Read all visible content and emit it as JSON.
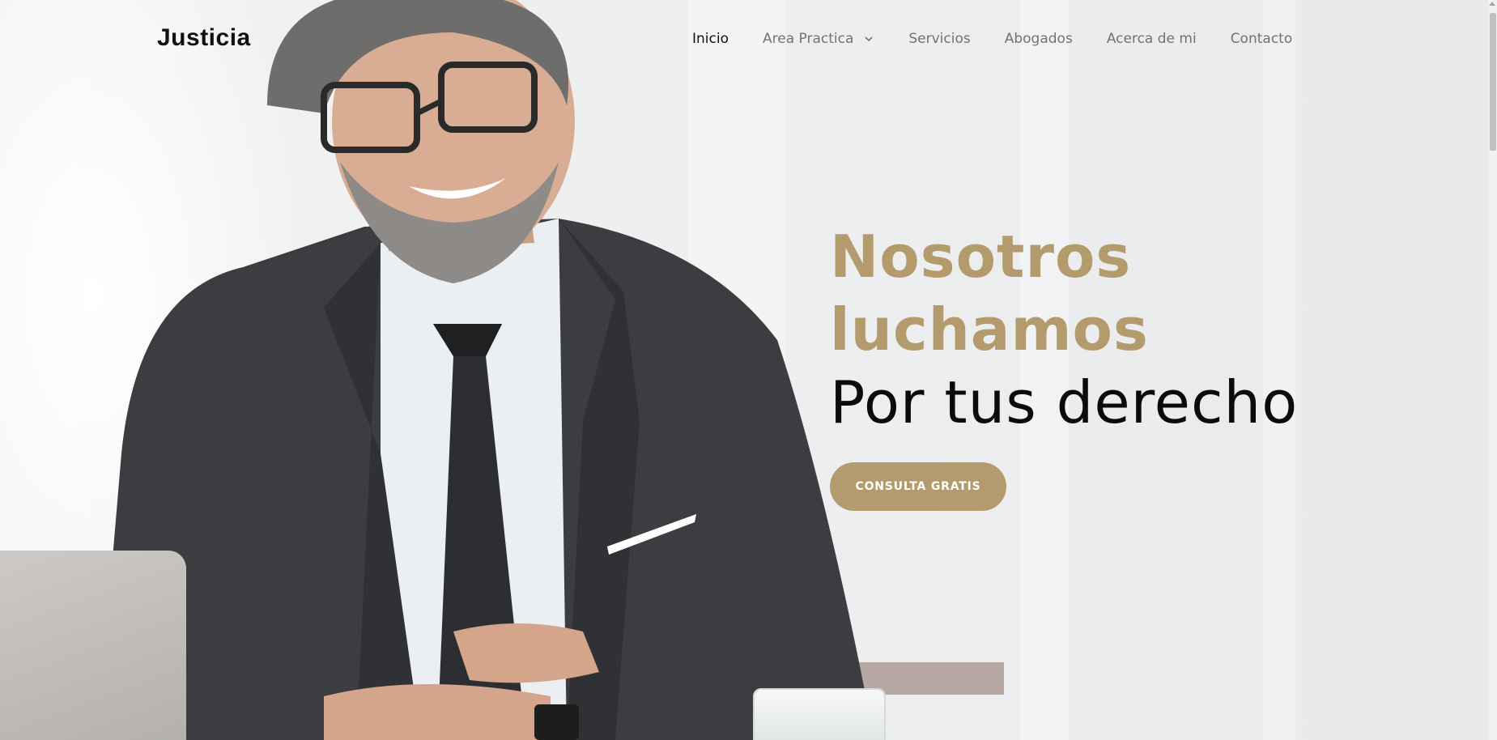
{
  "brand": {
    "name": "Justicia"
  },
  "nav": {
    "items": [
      {
        "label": "Inicio",
        "active": true
      },
      {
        "label": "Area Practica",
        "has_dropdown": true
      },
      {
        "label": "Servicios"
      },
      {
        "label": "Abogados"
      },
      {
        "label": "Acerca de mi"
      },
      {
        "label": "Contacto"
      }
    ]
  },
  "hero": {
    "line1": "Nosotros",
    "line2": "luchamos",
    "line3": "Por tus derecho",
    "cta_label": "CONSULTA GRATIS",
    "photo_alt": "smiling-lawyer-in-suit"
  },
  "colors": {
    "accent": "#b49b6d",
    "text_dark": "#0b0b0b",
    "nav_text": "#707375"
  },
  "icons": {
    "dropdown": "chevron-down-icon"
  }
}
